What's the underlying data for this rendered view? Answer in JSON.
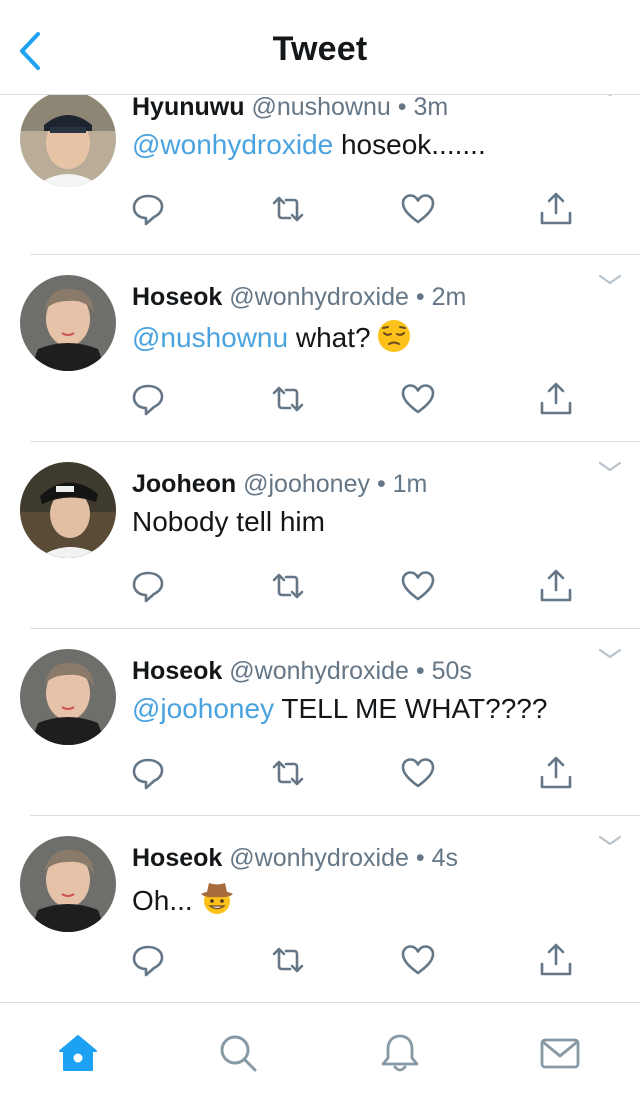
{
  "header": {
    "title": "Tweet"
  },
  "tweets": [
    {
      "name": "Hyunuwu",
      "handle": "@nushownu",
      "time": "3m",
      "mention": "@wonhydroxide",
      "text": " hoseok.......",
      "emoji": ""
    },
    {
      "name": "Hoseok",
      "handle": "@wonhydroxide",
      "time": "2m",
      "mention": "@nushownu",
      "text": " what?",
      "emoji": "pensive-face-emoji"
    },
    {
      "name": "Jooheon",
      "handle": "@joohoney",
      "time": "1m",
      "mention": "",
      "text": "Nobody tell him",
      "emoji": ""
    },
    {
      "name": "Hoseok",
      "handle": "@wonhydroxide",
      "time": "50s",
      "mention": "@joohoney",
      "text": " TELL ME WHAT????",
      "emoji": ""
    },
    {
      "name": "Hoseok",
      "handle": "@wonhydroxide",
      "time": "4s",
      "mention": "",
      "text": "Oh...",
      "emoji": "cowboy-face-emoji"
    }
  ],
  "separator": "•",
  "colors": {
    "accent": "#1da1f2",
    "mention": "#4aa3df",
    "muted": "#657786",
    "divider": "#d9dde0"
  },
  "tabbar": {
    "items": [
      "home-icon",
      "search-icon",
      "notifications-icon",
      "messages-icon"
    ],
    "active": "home-icon"
  }
}
